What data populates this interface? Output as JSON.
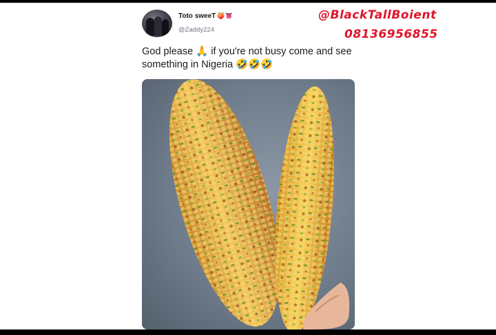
{
  "tweet": {
    "display_name": "Toto sweeT",
    "display_name_emoji": "🍑👅",
    "handle": "@Zaddy224",
    "text_line1": "God please 🙏 if you're not busy come and see",
    "text_line2": "something in Nigeria 🤣🤣🤣"
  },
  "watermark": {
    "line1": "@BlackTallBoient",
    "line2": "08136956855"
  },
  "photo": {
    "subject": "grilled corn on the cob with spring onions"
  },
  "colors": {
    "watermark": "#e0142b",
    "text": "#1b1b1b",
    "handle": "#6d7780",
    "frame": "#000000"
  }
}
